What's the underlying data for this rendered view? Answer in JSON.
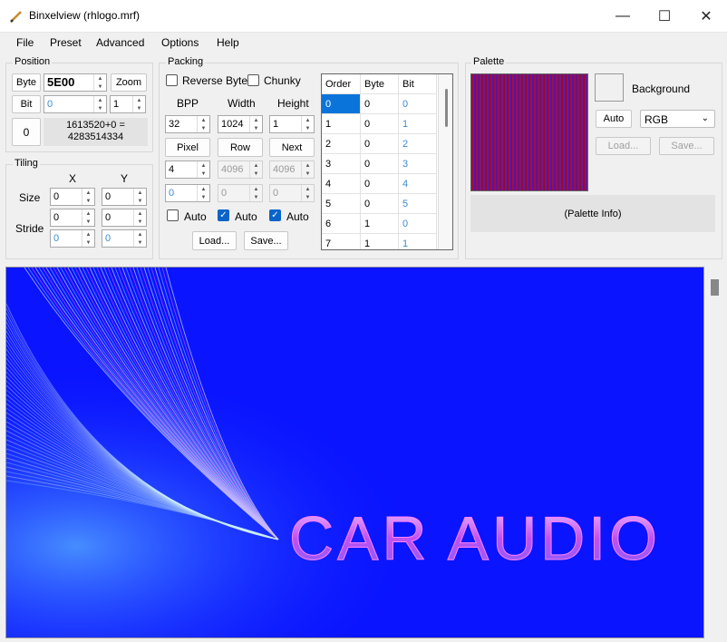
{
  "window": {
    "title": "Binxelview (rhlogo.mrf)",
    "minimize": "—",
    "maximize": "☐",
    "close": "✕"
  },
  "menu": [
    "File",
    "Preset",
    "Advanced",
    "Options",
    "Help"
  ],
  "position": {
    "label": "Position",
    "byte_button": "Byte",
    "byte_value": "5E00",
    "zoom_button": "Zoom",
    "bit_button": "Bit",
    "bit_value": "0",
    "zoom_value": "1",
    "zero_button": "0",
    "info_line1": "1613520+0 =",
    "info_line2": "4283514334"
  },
  "tiling": {
    "label": "Tiling",
    "x_label": "X",
    "y_label": "Y",
    "size_label": "Size",
    "stride_label": "Stride",
    "size_x": "0",
    "size_y": "0",
    "stride_x": "0",
    "stride_y": "0",
    "stride2_x": "0",
    "stride2_y": "0"
  },
  "packing": {
    "label": "Packing",
    "reverse_byte": "Reverse Byte",
    "chunky": "Chunky",
    "bpp_label": "BPP",
    "width_label": "Width",
    "height_label": "Height",
    "bpp": "32",
    "width": "1024",
    "height": "1",
    "pixel_button": "Pixel",
    "row_button": "Row",
    "next_button": "Next",
    "pixel_val": "4",
    "row_val": "4096",
    "next_val": "4096",
    "pixel_val2": "0",
    "row_val2": "0",
    "next_val2": "0",
    "auto": "Auto",
    "load_button": "Load...",
    "save_button": "Save..."
  },
  "order_table": {
    "headers": [
      "Order",
      "Byte",
      "Bit"
    ],
    "rows": [
      [
        "0",
        "0",
        "0"
      ],
      [
        "1",
        "0",
        "1"
      ],
      [
        "2",
        "0",
        "2"
      ],
      [
        "3",
        "0",
        "3"
      ],
      [
        "4",
        "0",
        "4"
      ],
      [
        "5",
        "0",
        "5"
      ],
      [
        "6",
        "1",
        "0"
      ],
      [
        "7",
        "1",
        "1"
      ]
    ]
  },
  "palette": {
    "label": "Palette",
    "background_label": "Background",
    "auto_button": "Auto",
    "mode": "RGB",
    "load_button": "Load...",
    "save_button": "Save...",
    "info_button": "(Palette Info)"
  },
  "preview": {
    "text": "CAR AUDIO",
    "colors": {
      "bg": "#0a14ff",
      "accent": "#e058ff"
    }
  }
}
